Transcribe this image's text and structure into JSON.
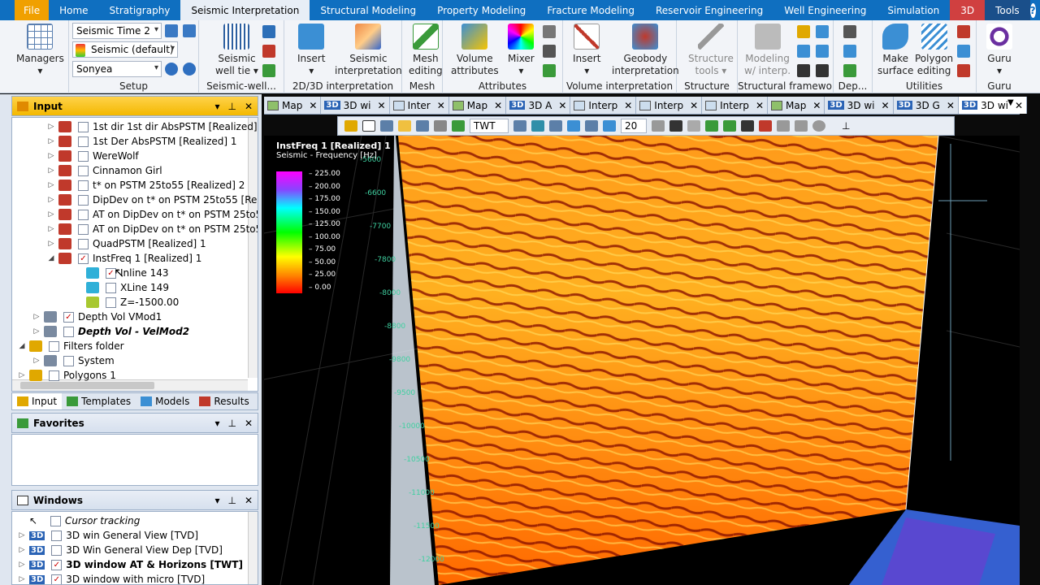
{
  "menu": [
    "File",
    "Home",
    "Stratigraphy",
    "Seismic Interpretation",
    "Structural Modeling",
    "Property Modeling",
    "Fracture Modeling",
    "Reservoir Engineering",
    "Well Engineering",
    "Simulation",
    "3D",
    "Tools"
  ],
  "ribbon": {
    "managers": "Managers",
    "setup": {
      "combo1": "Seismic Time 2",
      "combo2": "Seismic (default)",
      "combo3": "Sonyea",
      "label": "Setup"
    },
    "seismic_well_tie": {
      "btn": "Seismic\nwell tie",
      "label": "Seismic-well..."
    },
    "interp_2d3d": {
      "insert": "Insert",
      "seismic_interp": "Seismic\ninterpretation",
      "label": "2D/3D interpretation"
    },
    "mesh": {
      "btn": "Mesh\nediting",
      "label": "Mesh"
    },
    "attributes": {
      "volume": "Volume\nattributes",
      "mixer": "Mixer",
      "label": "Attributes"
    },
    "volume_interp": {
      "insert": "Insert",
      "geobody": "Geobody\ninterpretation",
      "label": "Volume interpretation"
    },
    "structure": {
      "btn": "Structure\ntools",
      "label": "Structure"
    },
    "structural_framework": {
      "btn": "Modeling\nw/ interp.",
      "label": "Structural framework"
    },
    "dep": {
      "label": "Dep..."
    },
    "utilities": {
      "make_surface": "Make\nsurface",
      "polygon": "Polygon\nediting",
      "label": "Utilities"
    },
    "guru": {
      "btn": "Guru",
      "label": "Guru"
    }
  },
  "input_panel": {
    "title": "Input",
    "items": [
      {
        "label": "1st dir 1st dir AbsPSTM [Realized] 1",
        "level": 3,
        "checked": false,
        "bold": false,
        "italic": false
      },
      {
        "label": "1st Der AbsPSTM [Realized] 1",
        "level": 3,
        "checked": false,
        "bold": false,
        "italic": false
      },
      {
        "label": "WereWolf",
        "level": 3,
        "checked": false,
        "bold": false,
        "italic": false
      },
      {
        "label": "Cinnamon Girl",
        "level": 3,
        "checked": false,
        "bold": false,
        "italic": false
      },
      {
        "label": "t* on PSTM 25to55 [Realized] 2",
        "level": 3,
        "checked": false,
        "bold": false,
        "italic": false
      },
      {
        "label": "DipDev on t* on PSTM 25to55 [Realize",
        "level": 3,
        "checked": false,
        "bold": false,
        "italic": false
      },
      {
        "label": "AT on DipDev on t* on PSTM 25to55 [F",
        "level": 3,
        "checked": false,
        "bold": false,
        "italic": false
      },
      {
        "label": "AT on DipDev on t* on PSTM 25to55 [F",
        "level": 3,
        "checked": false,
        "bold": false,
        "italic": false
      },
      {
        "label": "QuadPSTM [Realized] 1",
        "level": 3,
        "checked": false,
        "bold": false,
        "italic": false
      },
      {
        "label": "InstFreq 1 [Realized] 1",
        "level": 3,
        "checked": true,
        "bold": false,
        "italic": false,
        "expanded": true
      },
      {
        "label": "Inline 143",
        "level": 4,
        "checked": true,
        "bold": false,
        "italic": false
      },
      {
        "label": "XLine 149",
        "level": 4,
        "checked": false,
        "bold": false,
        "italic": false
      },
      {
        "label": "Z=-1500.00",
        "level": 4,
        "checked": false,
        "bold": false,
        "italic": false
      },
      {
        "label": "Depth Vol VMod1",
        "level": 2,
        "checked": true,
        "bold": false,
        "italic": false
      },
      {
        "label": "Depth Vol - VelMod2",
        "level": 2,
        "checked": false,
        "bold": true,
        "italic": true
      },
      {
        "label": "Filters folder",
        "level": 1,
        "checked": false,
        "bold": false,
        "italic": false,
        "expanded": true
      },
      {
        "label": "System",
        "level": 2,
        "checked": false,
        "bold": false,
        "italic": false
      },
      {
        "label": "Polygons 1",
        "level": 1,
        "checked": false,
        "bold": false,
        "italic": false
      }
    ]
  },
  "bottom_tabs": [
    "Input",
    "Templates",
    "Models",
    "Results"
  ],
  "favorites": {
    "title": "Favorites"
  },
  "windows_panel": {
    "title": "Windows",
    "items": [
      {
        "label": "Cursor tracking",
        "italic": true,
        "bold": false,
        "checked": false
      },
      {
        "label": "3D win General View [TVD]",
        "italic": false,
        "bold": false,
        "checked": false
      },
      {
        "label": "3D Win General View Dep [TVD]",
        "italic": false,
        "bold": false,
        "checked": false
      },
      {
        "label": "3D window AT & Horizons [TWT]",
        "italic": false,
        "bold": true,
        "checked": true
      },
      {
        "label": "3D window with micro [TVD]",
        "italic": false,
        "bold": false,
        "checked": true
      }
    ]
  },
  "doc_tabs": [
    {
      "type": "map",
      "label": "Map"
    },
    {
      "type": "3d",
      "label": "3D wi"
    },
    {
      "type": "interp",
      "label": "Inter"
    },
    {
      "type": "map",
      "label": "Map"
    },
    {
      "type": "3d",
      "label": "3D A"
    },
    {
      "type": "interp",
      "label": "Interp"
    },
    {
      "type": "interp",
      "label": "Interp"
    },
    {
      "type": "interp",
      "label": "Interp"
    },
    {
      "type": "map",
      "label": "Map"
    },
    {
      "type": "3d",
      "label": "3D wi"
    },
    {
      "type": "3d",
      "label": "3D G"
    },
    {
      "type": "3d",
      "label": "3D wi",
      "active": true
    }
  ],
  "toolbar3d": {
    "domain": "TWT",
    "zoom": "20"
  },
  "legend": {
    "title": "InstFreq 1 [Realized] 1",
    "subtitle": "Seismic - Frequency [Hz]",
    "ticks": [
      "225.00",
      "200.00",
      "175.00",
      "150.00",
      "125.00",
      "100.00",
      "75.00",
      "50.00",
      "25.00",
      "0.00"
    ]
  },
  "axis_labels": [
    "-5600",
    "-6600",
    "-7700",
    "-7800",
    "-8000",
    "-8800",
    "-9800",
    "-9500",
    "-10000",
    "-10500",
    "-11000",
    "-11500",
    "-12000"
  ]
}
